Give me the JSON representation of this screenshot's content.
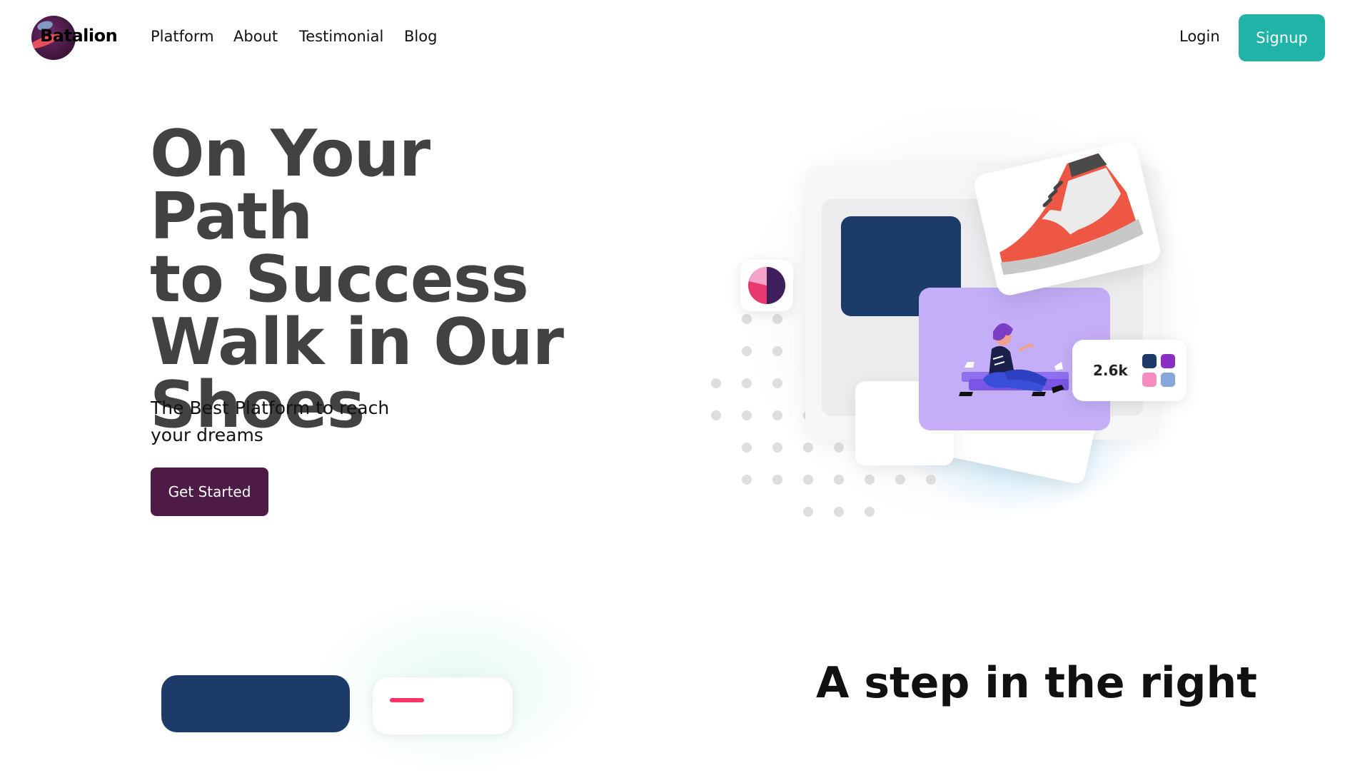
{
  "nav": {
    "brand": "Batalion",
    "links": [
      "Platform",
      "About",
      "Testimonial",
      "Blog"
    ],
    "login": "Login",
    "signup": "Signup"
  },
  "hero": {
    "title_lines": [
      "On Your Path",
      "to Success",
      "Walk in Our",
      "Shoes"
    ],
    "subtitle_lines": [
      "The Best Platform to reach",
      "your dreams"
    ],
    "cta": "Get Started"
  },
  "illustration": {
    "stat_value": "2.6k",
    "swatches": [
      "#1d3b69",
      "#8a2fc4",
      "#f58cc0",
      "#86a6dc"
    ],
    "navy": "#1d3b69",
    "purple": "#c3aef7",
    "shoe_red": "#ee5744",
    "pie_colors": [
      "#f6a4c8",
      "#3e1f5c",
      "#e83a6e"
    ]
  },
  "section2": {
    "title": "A step in the right"
  },
  "colors": {
    "accent": "#22b3a8",
    "cta": "#4d1b45",
    "heading": "#424242"
  }
}
